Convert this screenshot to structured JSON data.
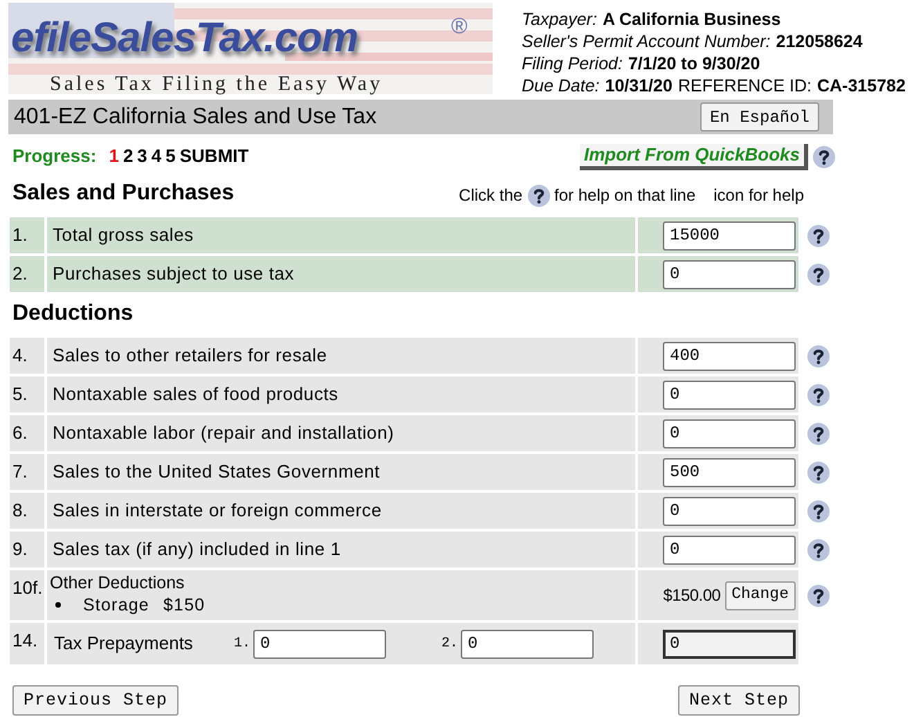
{
  "logo": {
    "name": "efileSalesTax.com",
    "mark": "®",
    "tagline": "Sales Tax Filing the Easy Way"
  },
  "info": [
    [
      {
        "kind": "field",
        "label": "Taxpayer:",
        "value": "A California Business"
      }
    ],
    [
      {
        "kind": "field",
        "label": "Seller's Permit Account Number:",
        "value": "212058624"
      }
    ],
    [
      {
        "kind": "field",
        "label": "Filing Period:",
        "value": "7/1/20 to 9/30/20"
      }
    ],
    [
      {
        "kind": "field",
        "label": "Due Date:",
        "value": "10/31/20"
      },
      {
        "kind": "plain",
        "label": "REFERENCE ID:",
        "value": "CA-315782"
      }
    ]
  ],
  "title_bar": {
    "title": "401-EZ California Sales and Use Tax",
    "language_button": "En Español"
  },
  "progress": {
    "label": "Progress:",
    "steps": [
      {
        "label": "1",
        "selected": true
      },
      {
        "label": "2",
        "selected": false
      },
      {
        "label": "3",
        "selected": false
      },
      {
        "label": "4",
        "selected": false
      },
      {
        "label": "5",
        "selected": false
      },
      {
        "label": "SUBMIT",
        "selected": false
      }
    ]
  },
  "import_button": "Import From QuickBooks",
  "help_hint": {
    "before": "Click the",
    "after": "for help on that line",
    "extra": "icon for help"
  },
  "sections": [
    {
      "title": "Sales and Purchases",
      "color": "#cfe0d0",
      "hint": true,
      "rows": [
        {
          "kind": "input",
          "number": "1.",
          "label": "Total gross sales",
          "value": "15000",
          "help": true
        },
        {
          "kind": "input",
          "number": "2.",
          "label": "Purchases subject to use tax",
          "value": "0",
          "help": true
        }
      ]
    },
    {
      "title": "Deductions",
      "color": "#e6e6e6",
      "hint": false,
      "rows": [
        {
          "kind": "input",
          "number": "4.",
          "label": "Sales to other retailers for resale",
          "value": "400",
          "help": true
        },
        {
          "kind": "input",
          "number": "5.",
          "label": "Nontaxable sales of food products",
          "value": "0",
          "help": true
        },
        {
          "kind": "input",
          "number": "6.",
          "label": "Nontaxable labor (repair and installation)",
          "value": "0",
          "help": true
        },
        {
          "kind": "input",
          "number": "7.",
          "label": "Sales to the United States Government",
          "value": "500",
          "help": true
        },
        {
          "kind": "input",
          "number": "8.",
          "label": "Sales in interstate or foreign commerce",
          "value": "0",
          "help": true
        },
        {
          "kind": "input",
          "number": "9.",
          "label": "Sales tax (if any) included in line 1",
          "value": "0",
          "help": true
        },
        {
          "kind": "other",
          "number": "10f.",
          "label": "Other Deductions",
          "items": [
            {
              "name": "Storage",
              "amount": "$150"
            }
          ],
          "total": "$150.00",
          "button": "Change",
          "help": true
        },
        {
          "kind": "prepay",
          "number": "14.",
          "label": "Tax Prepayments",
          "fields": [
            {
              "label": "1.",
              "value": "0"
            },
            {
              "label": "2.",
              "value": "0"
            }
          ],
          "total": "0",
          "help": false
        }
      ]
    }
  ],
  "buttons": {
    "previous": "Previous Step",
    "next": "Next Step"
  }
}
